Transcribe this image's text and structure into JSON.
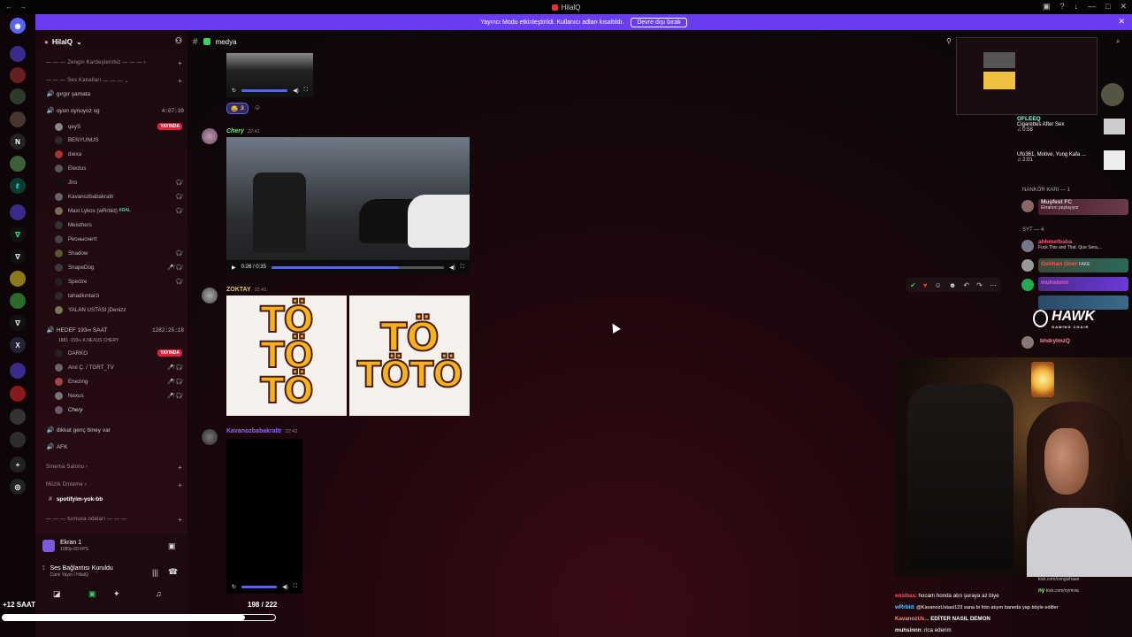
{
  "window": {
    "title": "HilalQ"
  },
  "banner": {
    "text": "Yayıncı Modu etkinleştirildi. Kullanıcı adları kısaltıldı.",
    "button": "Devre dışı bırak"
  },
  "guild": {
    "name": "HilalQ"
  },
  "channels": {
    "cat_zengin": "Zengin Kardeşlerimiz",
    "cat_ses": "Ses Kanalları",
    "vc1": "gırgır şamata",
    "vc2": "oyun oynuyoz sg",
    "vc2_timer": "4:07:39",
    "vc2_users": [
      "qeyS",
      "BENYUNUS",
      "dıexa",
      "Electus",
      "Jiro",
      "Kavanozbabakraltr",
      "Maxi Lykos (wRrbld)",
      "Meisthers",
      "Ресныснетt",
      "Shadow",
      "SnapeDog",
      "Spectre",
      "tahadkıntarzi",
      "YALAN USTASI jDenizz"
    ],
    "live_label": "YAYINDA",
    "maxi_tag": "KRAL",
    "vc3": "HEDEF 193∞ SAAT",
    "vc3_timer": "1282:25:18",
    "vc3_sub": "1881 -193∞ K.NEXUS CHERY",
    "vc3_users": [
      "DARKO",
      "Anıl Ç. / TGRT_TV",
      "Enezing",
      "Nexus",
      "Chery"
    ],
    "vc4": "dikkat genç biney var",
    "vc5": "AFK",
    "cat_sinema": "Sinema Salonu",
    "cat_muzik": "Müzik Dinleme",
    "text_spotify": "spotifyim-yok-bb",
    "cat_turnuva": "turnuva odaları"
  },
  "panel": {
    "screen": "Ekran 1",
    "screen_sub": "1080p 60 FPS",
    "voice": "Ses Bağlantısı Kuruldu",
    "voice_sub": "Canlı Yayın / HilalQ",
    "counter_left": "+12 SAAT",
    "counter_right": "198 / 222",
    "progress": 0.89
  },
  "chat": {
    "channel": "medya",
    "reaction_count": "3",
    "msg1": {
      "author": "Chery",
      "time": "22:41",
      "video_time": "0:26 / 0:35",
      "video_progress": 0.74
    },
    "msg2": {
      "author": "ZOKTAY",
      "time": "22:41"
    },
    "msg3": {
      "author": "Kavanozbabakraltr",
      "time": "22:42"
    },
    "toto1": [
      "TÖ",
      "TÖ",
      "TÖ"
    ],
    "toto2": [
      "TÖ",
      "TÖTÖ"
    ]
  },
  "members": {
    "m1_name": "OFLEEQ",
    "m1_act": "Cigarettes After Sex",
    "m1_time": "0:58",
    "m2_act": "Ufo361, Motive, Yung Kafa ...",
    "m2_time": "2:01",
    "cat_nankor": "NANKÖR KARI — 1",
    "m3_name": "Muşfest FC",
    "m3_act": "Ekranını paylaşıyor",
    "cat_syt": "SYT — 4",
    "m4_name": "ahhmetbaba",
    "m4_act": "Fuck This and That. Que Sera,...",
    "m5_name": "Gokhan Oner",
    "m5_tag": "FAKE",
    "m6_name": "muhsinnn",
    "m7_name": "bhdrylmzQ",
    "hawk": "HAWK",
    "hawk_sub": "GAMING CHAIR"
  },
  "stream_chat": [
    {
      "name": "kick.com/cengizhaan",
      "text": ""
    },
    {
      "name": "ny",
      "text": "kick.com/nymvia"
    },
    {
      "name": "ensibas",
      "text": ": hocam honda atın şuraya az biye"
    },
    {
      "name": "wRrbld",
      "text": ": @KavanozUstasi123 sana bi foto atıym baneda yap böyle editler"
    },
    {
      "name": "KavanozUs...",
      "text": "EDİTER NASIL DEMON"
    },
    {
      "name": "muhsinnn",
      "text": ": rica ederim"
    }
  ],
  "colors": {
    "banner": "#6a3cf0",
    "accent": "#5865f2",
    "live": "#e0203c"
  }
}
